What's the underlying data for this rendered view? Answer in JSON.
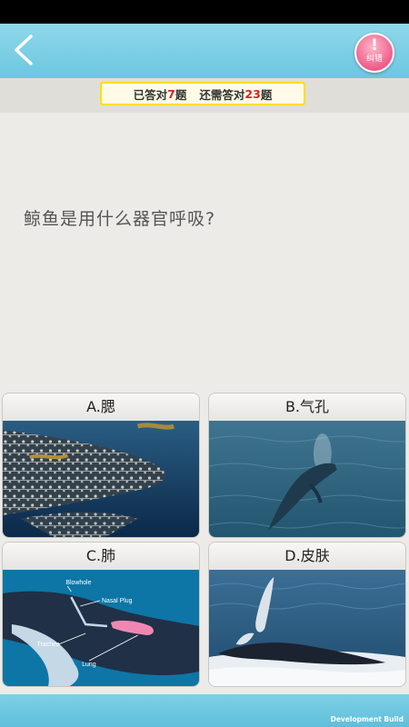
{
  "header": {
    "report_label": "纠错",
    "report_mark": "!"
  },
  "progress": {
    "prefix": "已答对",
    "answered": "7",
    "unit1": "题",
    "middle": "还需答对",
    "remaining": "23",
    "unit2": "题"
  },
  "question": {
    "text": "鲸鱼是用什么器官呼吸?"
  },
  "options": [
    {
      "label": "A.腮"
    },
    {
      "label": "B.气孔"
    },
    {
      "label": "C.肺"
    },
    {
      "label": "D.皮肤"
    }
  ],
  "diagram_labels": {
    "blowhole": "Blowhole",
    "nasal_plug": "Nasal Plug",
    "trachea": "Trachea",
    "lung": "Lung"
  },
  "footer": {
    "build_label": "Development Build"
  },
  "colors": {
    "header_bg": "#6cc7e0",
    "progress_border": "#ffe000",
    "progress_number": "#e02020",
    "report_button": "#ef5b8a"
  }
}
